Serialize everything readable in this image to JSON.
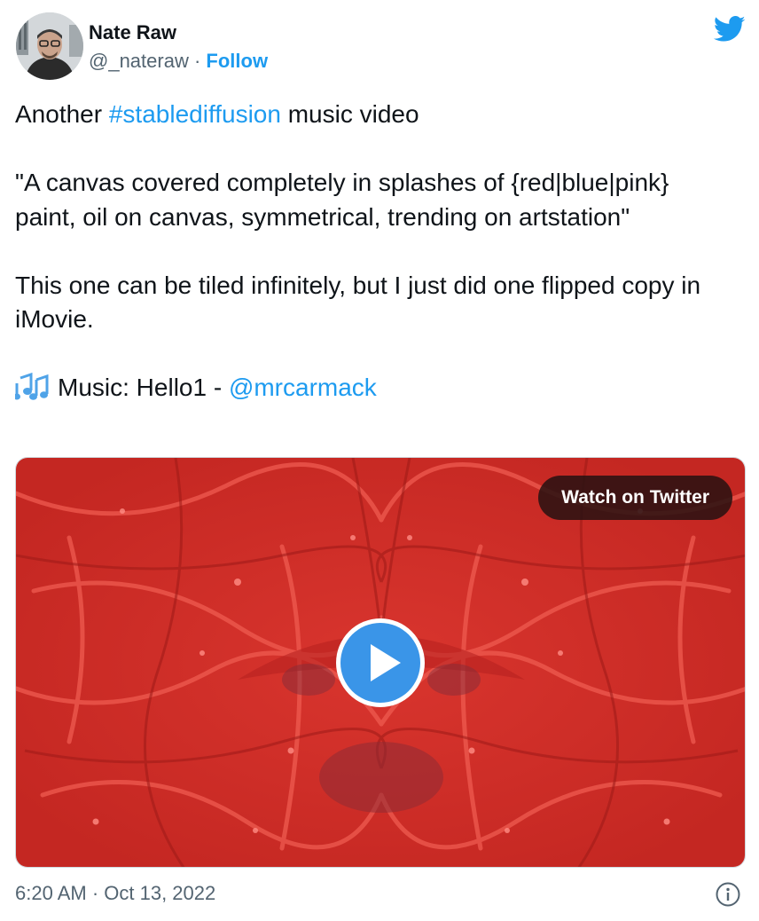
{
  "author": {
    "name": "Nate Raw",
    "handle": "@_nateraw",
    "separator": "·",
    "follow_label": "Follow"
  },
  "tweet": {
    "line1_prefix": "Another ",
    "hashtag": "#stablediffusion",
    "line1_suffix": " music video",
    "prompt_quote": "\"A canvas covered completely in splashes of {red|blue|pink} paint, oil on canvas, symmetrical, trending on artstation\"",
    "note": "This one can be tiled infinitely, but I just did one flipped copy in iMovie.",
    "music_prefix": "Music: Hello1 - ",
    "music_mention": "@mrcarmack",
    "music_icon": "musical-notes-icon"
  },
  "media": {
    "watch_label": "Watch on Twitter",
    "play_icon": "play-icon"
  },
  "footer": {
    "timestamp": "6:20 AM · Oct 13, 2022",
    "info_icon": "info-icon"
  },
  "colors": {
    "accent": "#1d9bf0",
    "text": "#0f1419",
    "secondary": "#536471",
    "paint": "#d8302c",
    "play": "#3a95e8"
  }
}
